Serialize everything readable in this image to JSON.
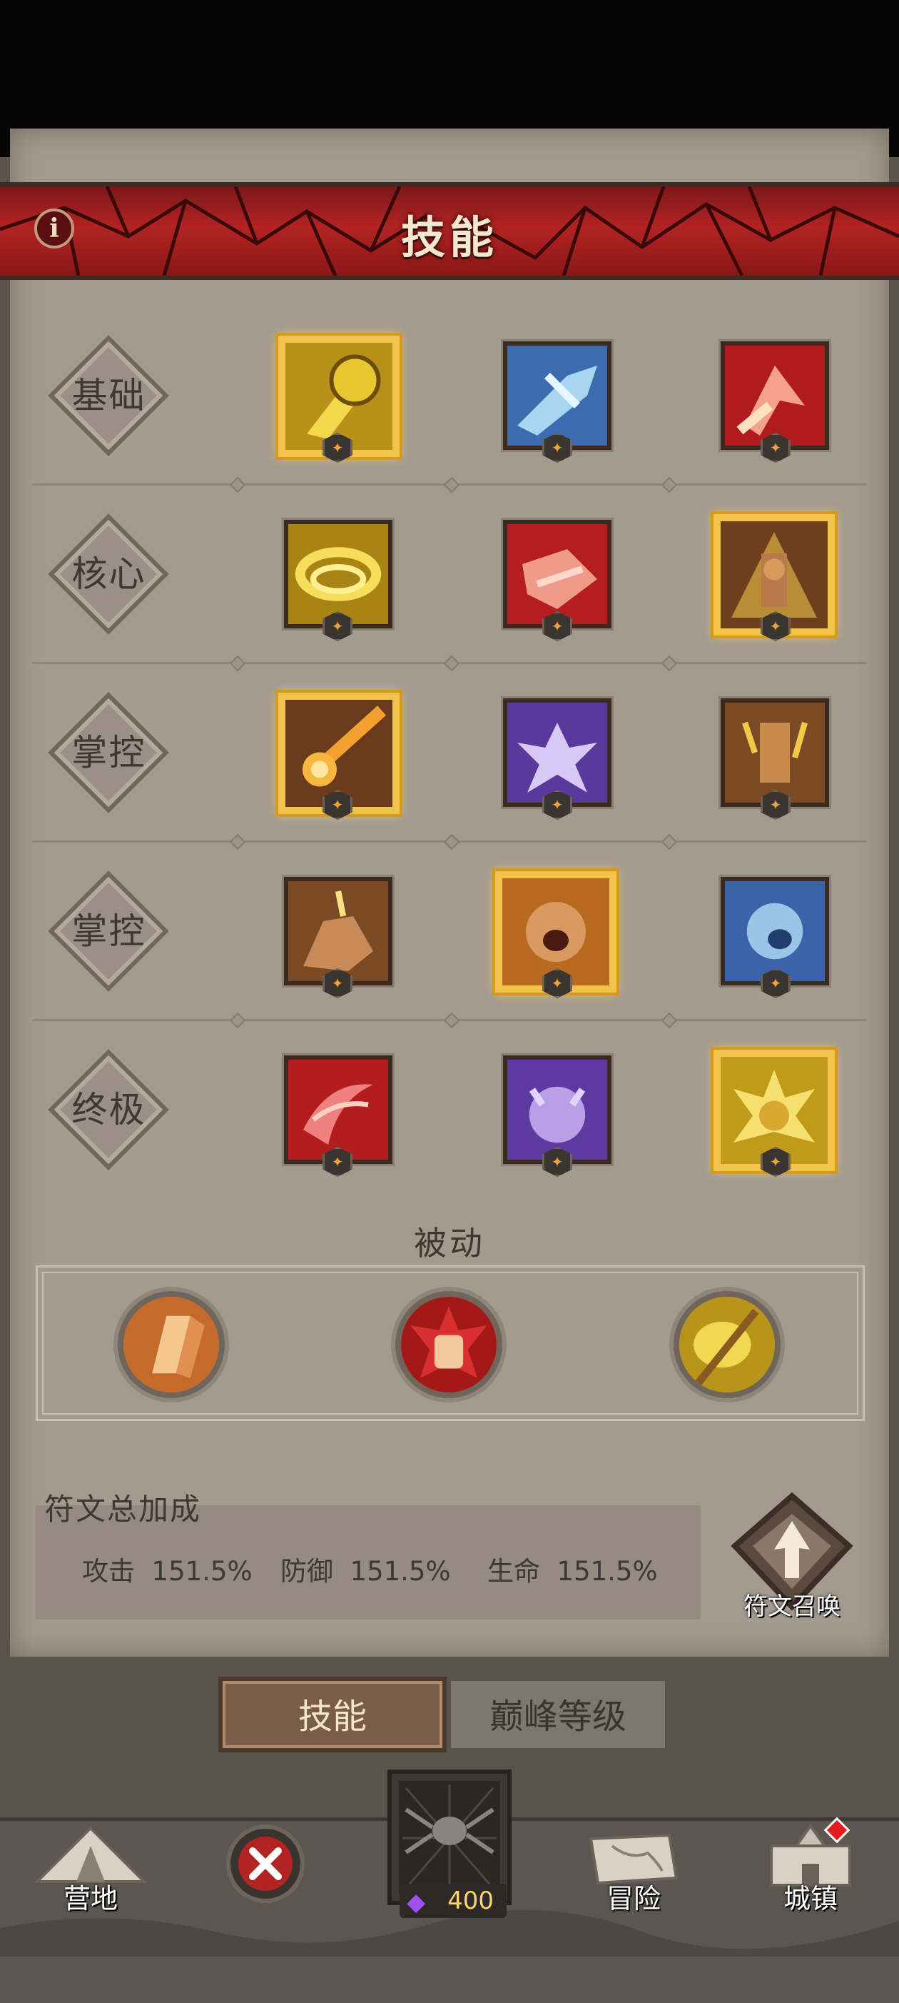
{
  "header": {
    "title": "技能",
    "info_icon": "i"
  },
  "rows": [
    {
      "label": "基础"
    },
    {
      "label": "核心"
    },
    {
      "label": "掌控"
    },
    {
      "label": "掌控"
    },
    {
      "label": "终极"
    }
  ],
  "passive": {
    "title": "被动"
  },
  "rune_bonus": {
    "title": "符文总加成",
    "stats": [
      {
        "label": "攻击",
        "value": "151.5%"
      },
      {
        "label": "防御",
        "value": "151.5%"
      },
      {
        "label": "生命",
        "value": "151.5%"
      }
    ],
    "summon_label": "符文召唤"
  },
  "tabs": {
    "skill": "技能",
    "peak": "巅峰等级"
  },
  "nav": {
    "camp": "营地",
    "adventure": "冒险",
    "town": "城镇",
    "gem_count": "400"
  },
  "colors": {
    "header_red": "#b32323",
    "active_frame": "#f2c34a",
    "panel_bg": "#a49b8f"
  }
}
